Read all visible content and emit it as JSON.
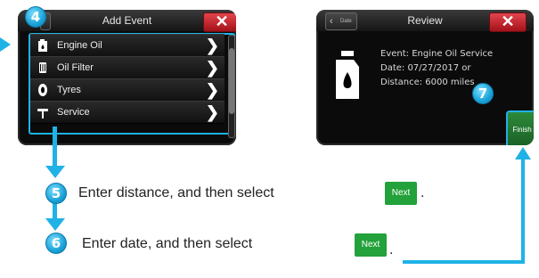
{
  "add_event": {
    "badge": "4",
    "title": "Add Event",
    "close": "✕",
    "items": [
      {
        "label": "Engine Oil"
      },
      {
        "label": "Oil Filter"
      },
      {
        "label": "Tyres"
      },
      {
        "label": "Service"
      }
    ],
    "chevron": "❯"
  },
  "review": {
    "title": "Review",
    "back_label": "Date",
    "close": "✕",
    "lines": [
      "Event: Engine Oil Service",
      "Date: 07/27/2017 or",
      "Distance: 6000 miles"
    ],
    "badge": "7",
    "finish": "Finish"
  },
  "steps": [
    {
      "number": "5",
      "text": "Enter distance, and then select",
      "button": "Next",
      "suffix": "."
    },
    {
      "number": "6",
      "text": "Enter date, and then select",
      "button": "Next",
      "suffix": "."
    }
  ],
  "colors": {
    "accent": "#1fb2e6",
    "next_green": "#23a13a",
    "close_red": "#d6262e"
  }
}
